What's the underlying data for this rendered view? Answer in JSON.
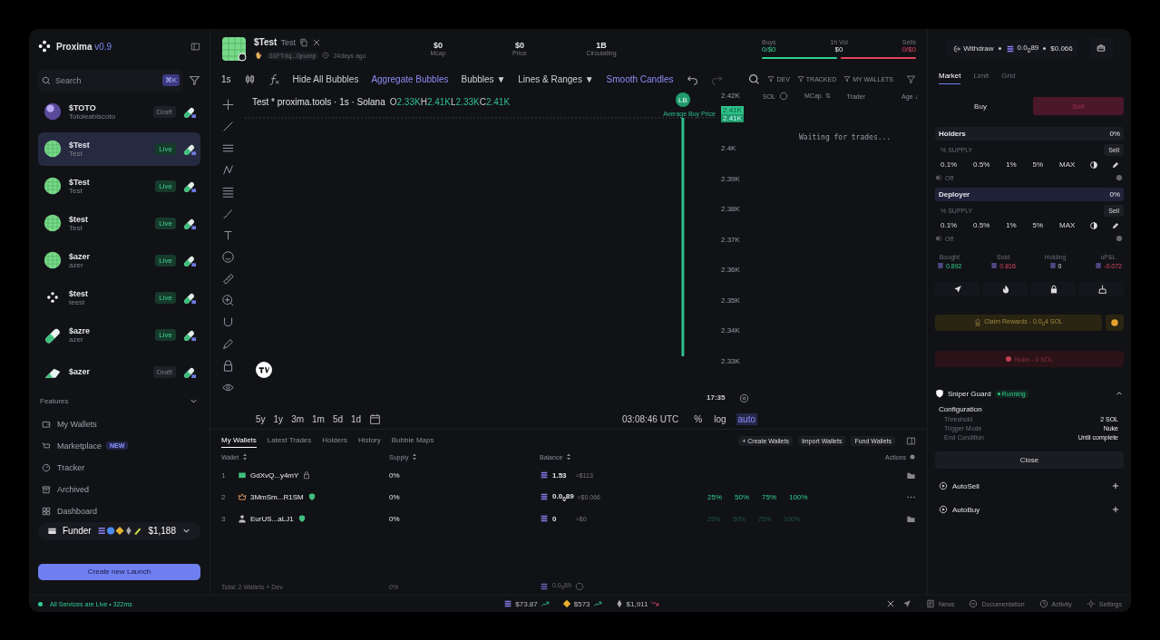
{
  "brand": {
    "name": "Proxima",
    "version": "v0.9"
  },
  "search": {
    "placeholder": "Search",
    "shortcut": "⌘K"
  },
  "launches": [
    {
      "ticker": "$TOTO",
      "name": "Totoleabiscoto",
      "status": "Draft",
      "live": false,
      "selected": false,
      "kind": "sphere"
    },
    {
      "ticker": "$Test",
      "name": "Test",
      "status": "Live",
      "live": true,
      "selected": true,
      "kind": "grid"
    },
    {
      "ticker": "$Test",
      "name": "Test",
      "status": "Live",
      "live": true,
      "selected": false,
      "kind": "grid"
    },
    {
      "ticker": "$test",
      "name": "Test",
      "status": "Live",
      "live": true,
      "selected": false,
      "kind": "grid"
    },
    {
      "ticker": "$azer",
      "name": "azer",
      "status": "Live",
      "live": true,
      "selected": false,
      "kind": "grid"
    },
    {
      "ticker": "$test",
      "name": "teest",
      "status": "Live",
      "live": true,
      "selected": false,
      "kind": "dots"
    },
    {
      "ticker": "$azre",
      "name": "azer",
      "status": "Live",
      "live": true,
      "selected": false,
      "kind": "pill"
    },
    {
      "ticker": "$azer",
      "status": "Draft",
      "live": false,
      "selected": false,
      "kind": "wedge"
    }
  ],
  "features": {
    "title": "Features",
    "expanded": true,
    "items": [
      {
        "label": "My Wallets"
      },
      {
        "label": "Marketplace",
        "badge": "NEW"
      },
      {
        "label": "Tracker"
      },
      {
        "label": "Archived"
      },
      {
        "label": "Dashboard"
      }
    ]
  },
  "funder": {
    "label": "Funder",
    "amount": "$1,188"
  },
  "create_button": "Create new Launch",
  "token": {
    "ticker": "$Test",
    "name": "Test",
    "address": "61FTdq...0pump",
    "age": "24days ago",
    "stats": [
      {
        "value": "$0",
        "label": "Mcap"
      },
      {
        "value": "$0",
        "label": "Price"
      },
      {
        "value": "1B",
        "label": "Circulating"
      }
    ],
    "buys_label": "Buys",
    "buys": "0/$0",
    "vol_label": "1h Vol",
    "vol": "$0",
    "sells_label": "Sells",
    "sells": "0/$0"
  },
  "toolbar": {
    "interval": "1s",
    "items": [
      {
        "label": "Hide All Bubbles",
        "active": false
      },
      {
        "label": "Aggregate Bubbles",
        "active": true
      },
      {
        "label": "Bubbles ▼",
        "active": false
      },
      {
        "label": "Lines & Ranges ▼",
        "active": false
      },
      {
        "label": "Smooth Candles",
        "active": true
      }
    ]
  },
  "chart": {
    "title": "Test * proxima.tools · 1s · Solana",
    "ohlc": [
      {
        "key": "O",
        "value": "2.33K"
      },
      {
        "key": "H",
        "value": "2.41K"
      },
      {
        "key": "L",
        "value": "2.33K"
      },
      {
        "key": "C",
        "value": "2.41K"
      }
    ],
    "marker": "LB",
    "marker_label": "Average Buy Price",
    "axis": [
      "2.42K",
      "2.4K",
      "2.39K",
      "2.38K",
      "2.37K",
      "2.36K",
      "2.35K",
      "2.34K",
      "2.33K"
    ],
    "price_tags": [
      "2.41K",
      "2.41K"
    ],
    "time": "17:35",
    "ranges": [
      "5y",
      "1y",
      "3m",
      "1m",
      "5d",
      "1d"
    ],
    "clock": "03:08:46 UTC",
    "scales": [
      {
        "label": "%",
        "selected": false
      },
      {
        "label": "log",
        "selected": false
      },
      {
        "label": "auto",
        "selected": true
      }
    ]
  },
  "trades": {
    "filters": [
      "DEV",
      "TRACKED",
      "MY WALLETS"
    ],
    "columns": [
      "SOL",
      "MCap. ⇅",
      "Trader",
      "Age ↓"
    ],
    "empty": "Waiting for trades..."
  },
  "wallets": {
    "tabs": [
      {
        "label": "My Wallets",
        "selected": true
      },
      {
        "label": "Latest Trades",
        "selected": false
      },
      {
        "label": "Holders",
        "selected": false
      },
      {
        "label": "History",
        "selected": false
      },
      {
        "label": "Bubble Maps",
        "selected": false
      }
    ],
    "actions": [
      "+ Create Wallets",
      "Import Wallets",
      "Fund Wallets"
    ],
    "columns": [
      "Wallet",
      "Supply",
      "Balance",
      "Actions"
    ],
    "rows": [
      {
        "index": "1",
        "kind": "dev",
        "verified": false,
        "wallet": "GdXvQ...y4mY",
        "supply": "0%",
        "balance": "1.53",
        "usd": "≈$113"
      },
      {
        "index": "2",
        "kind": "crown",
        "verified": true,
        "wallet": "3MmSm...R1SM",
        "supply": "0%",
        "balance": "0.0$_{0}$89",
        "usd": "≈$0.066",
        "presets": [
          "25%",
          "50%",
          "75%",
          "100%"
        ],
        "presets_enabled": true
      },
      {
        "index": "3",
        "kind": "person",
        "verified": true,
        "wallet": "EurUS...aLJ1",
        "supply": "0%",
        "balance": "0",
        "usd": "≈$0",
        "presets": [
          "25%",
          "50%",
          "75%",
          "100%"
        ],
        "presets_enabled": false
      }
    ],
    "total": {
      "label": "Total: 2 Wallets + Dev",
      "supply": "0%",
      "balance": "0.0$_{0}$89"
    }
  },
  "right": {
    "withdraw": "Withdraw",
    "balance": "0.0$_{0}$89",
    "usd": "$0.066",
    "tabs": [
      {
        "label": "Market",
        "selected": true
      },
      {
        "label": "Limit",
        "selected": false
      },
      {
        "label": "Grid",
        "selected": false
      }
    ],
    "sides": [
      {
        "label": "Buy",
        "selected": false
      },
      {
        "label": "Sell",
        "selected": true
      }
    ],
    "groups": [
      {
        "title": "Holders",
        "pct": "0%",
        "highlight": false,
        "supply_label": "% SUPPLY",
        "sell": "Sell",
        "presets": [
          "0.1%",
          "0.5%",
          "1%",
          "5%",
          "MAX"
        ],
        "auto": "Off"
      },
      {
        "title": "Deployer",
        "pct": "0%",
        "highlight": true,
        "supply_label": "% SUPPLY",
        "sell": "Sell",
        "presets": [
          "0.1%",
          "0.5%",
          "1%",
          "5%",
          "MAX"
        ],
        "auto": "Off"
      }
    ],
    "pnl": [
      {
        "label": "Bought",
        "value": "0.892",
        "kind": "up"
      },
      {
        "label": "Sold",
        "value": "0.816",
        "kind": "down"
      },
      {
        "label": "Holding",
        "value": "0",
        "kind": "flat"
      },
      {
        "label": "uP&L",
        "value": "-0.072",
        "kind": "down"
      }
    ],
    "claim": "Claim Rewards - 0.0$_{0}$4 SOL",
    "nuke": "Nuke - 0 SOL",
    "guard": {
      "title": "Sniper Guard",
      "status": "Running",
      "expanded": true,
      "config_title": "Configuration",
      "config": [
        {
          "label": "Threshold",
          "value": "2 SOL"
        },
        {
          "label": "Trigger Mode",
          "value": "Nuke"
        },
        {
          "label": "End Condition",
          "value": "Until complete"
        }
      ],
      "close": "Close"
    },
    "automations": [
      {
        "label": "AutoSell"
      },
      {
        "label": "AutoBuy"
      }
    ]
  },
  "status_bar": {
    "services": "All Services are Live • 322ms",
    "prices": [
      {
        "kind": "sol",
        "value": "$73.87",
        "rising": true
      },
      {
        "kind": "bnb",
        "value": "$573",
        "rising": true
      },
      {
        "kind": "eth",
        "value": "$1,911",
        "rising": false
      }
    ],
    "links": [
      {
        "label": "News"
      },
      {
        "label": "Documentation"
      },
      {
        "label": "Activity"
      },
      {
        "label": "Settings"
      }
    ]
  }
}
